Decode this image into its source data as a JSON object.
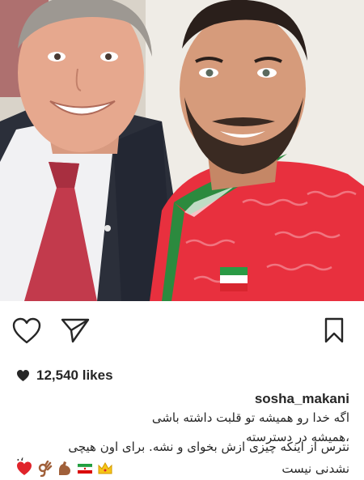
{
  "post": {
    "image_alt": "selfie photo",
    "likes_count": "12,540 likes",
    "username": "sosha_makani",
    "caption_lines": [
      "اگه خدا رو همیشه تو قلبت داشته باشی",
      "،همیشه در دسترسته",
      ".،",
      "نترس از اینکه چیزی ازش بخوای و نشه. برای اون هیچی",
      "نشدنی نیست"
    ],
    "caption_emojis": [
      "red-heart",
      "ok-hand",
      "flexed-biceps",
      "iran-flag",
      "crown"
    ]
  },
  "actions": {
    "like_icon": "heart-outline-icon",
    "share_icon": "paper-plane-icon",
    "save_icon": "bookmark-icon"
  },
  "colors": {
    "text": "#262626",
    "heart_red": "#e0242b",
    "jersey_red": "#e8303e"
  }
}
